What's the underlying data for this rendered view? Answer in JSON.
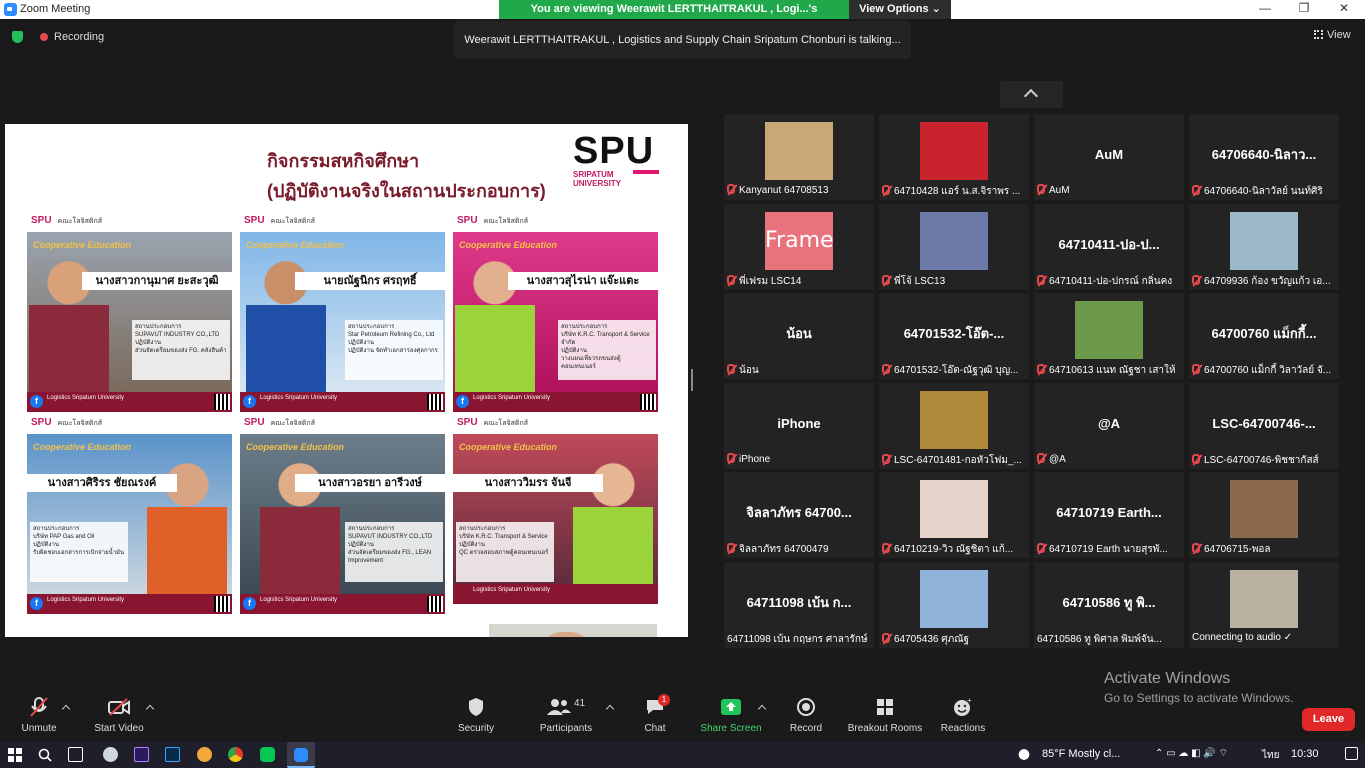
{
  "window": {
    "title": "Zoom Meeting"
  },
  "banner": {
    "viewing": "You are viewing Weerawit LERTTHAITRAKUL , Logi...'s PowerPoint",
    "view_options": "View Options"
  },
  "header": {
    "recording": "Recording",
    "talking": "Weerawit LERTTHAITRAKUL , Logistics and Supply Chain Sripatum Chonburi is talking...",
    "view": "View"
  },
  "slide": {
    "title_line1": "กิจกรรมสหกิจศึกษา",
    "title_line2": "(ปฏิบัติงานจริงในสถานประกอบการ)",
    "logo": "SPU",
    "logo_sub": "SRIPATUM\nUNIVERSITY",
    "cards": [
      {
        "head": "SPU",
        "coop": "Cooperative Education",
        "name": "นางสาวกานุมาศ ยะสะวุฒิ",
        "company": "SUPAVUT INDUSTRY CO.,LTD",
        "job": "ส่วนจัดเตรียมของส่ง FG. คลังสินค้า",
        "foot": "Logistics Sripatum University"
      },
      {
        "head": "SPU",
        "coop": "Cooperative Education",
        "name": "นายณัฐนิกร ศรฤทธิ์",
        "company": "Star Petroleum Refining Co., Ltd",
        "job": "ปฏิบัติงาน จัดทำเอกสารลงศุลกากร",
        "foot": "Logistics Sripatum University"
      },
      {
        "head": "SPU",
        "coop": "Cooperative Education",
        "name": "นางสาวสุไรน่า แจ๊ะแตะ",
        "company": "บริษัท K.R.C. Transport & Service จำกัด",
        "job": "วางแผนเที่ยวรถขนส่งตู้คอนเทนเนอร์",
        "foot": "Logistics Sripatum University"
      },
      {
        "head": "SPU",
        "coop": "Cooperative Education",
        "name": "นางสาวศิริรร ชัยณรงค์",
        "company": "บริษัท PAP Gas and Oil",
        "job": "รับผิดชอบเอกสารการเบิกจ่ายน้ำมัน",
        "foot": "Logistics Sripatum University"
      },
      {
        "head": "SPU",
        "coop": "Cooperative Education",
        "name": "นางสาวอรยา อารีวงษ์",
        "company": "SUPAVUT INDUSTRY CO.,LTD",
        "job": "ส่วนจัดเตรียมของส่ง FG., LEAN Improvement",
        "foot": "Logistics Sripatum University"
      },
      {
        "head": "SPU",
        "coop": "Cooperative Education",
        "name": "นางสาววิมรร จันจี",
        "company": "บริษัท K.R.C. Transport & Service",
        "job": "QC ตรวจสอบสภาพตู้คอนเทนเนอร์",
        "foot": "Logistics Sripatum University"
      }
    ]
  },
  "gallery": [
    {
      "display": "",
      "label": "Kanyanut 64708513",
      "muted": true,
      "photo": "#c9a777"
    },
    {
      "display": "",
      "label": "64710428 แอร์ น.ส.จิราพร ...",
      "muted": true,
      "photo": "#c9232e"
    },
    {
      "display": "AuM",
      "label": "AuM",
      "muted": true
    },
    {
      "display": "64706640-นิลาว...",
      "label": "64706640-นิลาวัลย์ นนท์ศิริ",
      "muted": true
    },
    {
      "display": "",
      "label": "พี่เฟรม LSC14",
      "muted": true,
      "photo": "#e8737c",
      "photo_text": "Frame"
    },
    {
      "display": "",
      "label": "พี่โจ้ LSC13",
      "muted": true,
      "photo": "#6b7aa8"
    },
    {
      "display": "64710411-ปอ-ป...",
      "label": "64710411-ปอ-ปกรณ์ กลิ่นคง",
      "muted": true
    },
    {
      "display": "",
      "label": "64709936 ก้อง ขวัญแก้ว เอ...",
      "muted": true,
      "photo": "#9bb8c8"
    },
    {
      "display": "น้อน",
      "label": "น้อน",
      "muted": true
    },
    {
      "display": "64701532-โอ๊ต-...",
      "label": "64701532-โอ๊ต-ณัฐวุฒิ บุญ...",
      "muted": true
    },
    {
      "display": "",
      "label": "64710613 แนท ณัฐชา เสาให้",
      "muted": true,
      "photo": "#6d9a4a"
    },
    {
      "display": "64700760 แม็กกี้...",
      "label": "64700760 แม็กกี้ วิลาวัลย์ จั...",
      "muted": true
    },
    {
      "display": "iPhone",
      "label": "iPhone",
      "muted": true
    },
    {
      "display": "",
      "label": "LSC-64701481-กอหัวโฟม_...",
      "muted": true,
      "photo": "#b08a3a"
    },
    {
      "display": "@A",
      "label": "@A",
      "muted": true
    },
    {
      "display": "LSC-64700746-...",
      "label": "LSC-64700746-พิชชากัสส์",
      "muted": true
    },
    {
      "display": "จิลลาภัทร 64700...",
      "label": "จิลลาภัทร 64700479",
      "muted": true
    },
    {
      "display": "",
      "label": "64710219-วิว ณัฐชิตา  แก้...",
      "muted": true,
      "photo": "#e6d2c8"
    },
    {
      "display": "64710719 Earth...",
      "label": "64710719 Earth นายสุรพั...",
      "muted": true
    },
    {
      "display": "",
      "label": "64706715-พอล",
      "muted": true,
      "photo": "#8a6a4a"
    },
    {
      "display": "64711098 เบ้น ก...",
      "label": "64711098 เบ้น กฤษกร ศาลารักษ์",
      "muted": false
    },
    {
      "display": "",
      "label": "64705436 ศุภณัฐ",
      "muted": true,
      "photo": "#8fb3d9"
    },
    {
      "display": "64710586  ทู   พิ...",
      "label": "64710586  ทู   พิศาล พิมพ์จัน...",
      "muted": false
    },
    {
      "display": "",
      "label": "Connecting to audio ✓",
      "muted": false,
      "photo": "#b8b0a0"
    }
  ],
  "watermark": {
    "line1": "Activate Windows",
    "line2": "Go to Settings to activate Windows."
  },
  "toolbar": {
    "unmute": "Unmute",
    "start_video": "Start Video",
    "security": "Security",
    "participants": "Participants",
    "participants_count": "41",
    "chat": "Chat",
    "chat_badge": "1",
    "share_screen": "Share Screen",
    "record": "Record",
    "breakout": "Breakout Rooms",
    "reactions": "Reactions",
    "leave": "Leave"
  },
  "taskbar": {
    "weather": "85°F  Mostly cl...",
    "lang": "ไทย",
    "time": "10:30"
  },
  "colors": {
    "accent_green": "#21a84a",
    "leave_red": "#e02828",
    "muted_red": "#e5484d",
    "spu_maroon": "#8a1530"
  }
}
